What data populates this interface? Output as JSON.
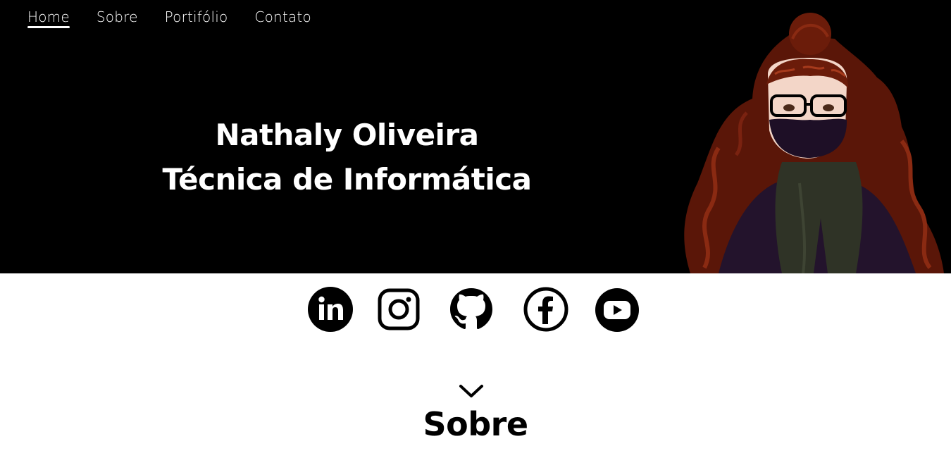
{
  "nav": {
    "items": [
      {
        "label": "Home",
        "active": true
      },
      {
        "label": "Sobre",
        "active": false
      },
      {
        "label": "Portifólio",
        "active": false
      },
      {
        "label": "Contato",
        "active": false
      }
    ]
  },
  "hero": {
    "name": "Nathaly Oliveira",
    "role": "Técnica de Informática",
    "avatar_icon": "illustrated-portrait"
  },
  "social": {
    "icons": [
      "linkedin-icon",
      "instagram-icon",
      "github-icon",
      "facebook-icon",
      "youtube-icon"
    ]
  },
  "section": {
    "scroll_icon": "chevron-down-icon",
    "title": "Sobre"
  },
  "colors": {
    "hero_bg": "#000000",
    "page_bg": "#ffffff",
    "text_light": "#ffffff",
    "text_dark": "#000000"
  }
}
